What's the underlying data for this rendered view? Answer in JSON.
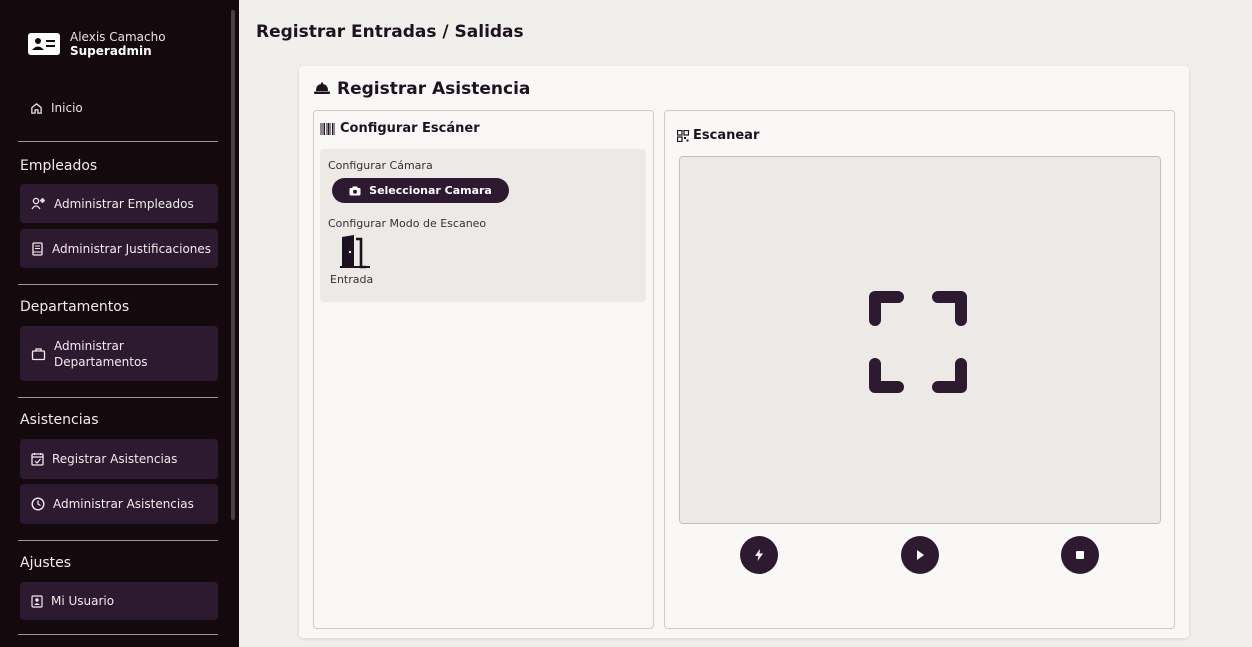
{
  "sidebar": {
    "user": {
      "name": "Alexis Camacho",
      "role": "Superadmin"
    },
    "home_label": "Inicio",
    "sections": [
      {
        "title": "Empleados",
        "items": [
          "Administrar Empleados",
          "Administrar Justificaciones"
        ]
      },
      {
        "title": "Departamentos",
        "items": [
          "Administrar Departamentos"
        ]
      },
      {
        "title": "Asistencias",
        "items": [
          "Registrar Asistencias",
          "Administrar Asistencias"
        ]
      },
      {
        "title": "Ajustes",
        "items": [
          "Mi Usuario"
        ]
      }
    ],
    "departments_item_lines": [
      "Administrar",
      "Departamentos"
    ]
  },
  "header": {
    "title": "Registrar Entradas / Salidas"
  },
  "card": {
    "title": "Registrar Asistencia",
    "config": {
      "title": "Configurar Escáner",
      "camera_label": "Configurar Cámara",
      "camera_button": "Seleccionar Camara",
      "mode_label": "Configurar Modo de Escaneo",
      "mode_value": "Entrada"
    },
    "scan": {
      "title": "Escanear"
    }
  },
  "colors": {
    "sidebar_bg": "#140a0d",
    "accent": "#2e1a30",
    "page_bg": "#f1efec"
  },
  "icons": [
    "id-card-icon",
    "home-icon",
    "users-cog-icon",
    "journal-icon",
    "briefcase-icon",
    "calendar-check-icon",
    "clock-icon",
    "user-badge-icon",
    "hard-hat-icon",
    "barcode-icon",
    "camera-icon",
    "door-icon",
    "qr-icon",
    "scan-frame-icon",
    "flash-icon",
    "play-icon",
    "stop-icon"
  ]
}
